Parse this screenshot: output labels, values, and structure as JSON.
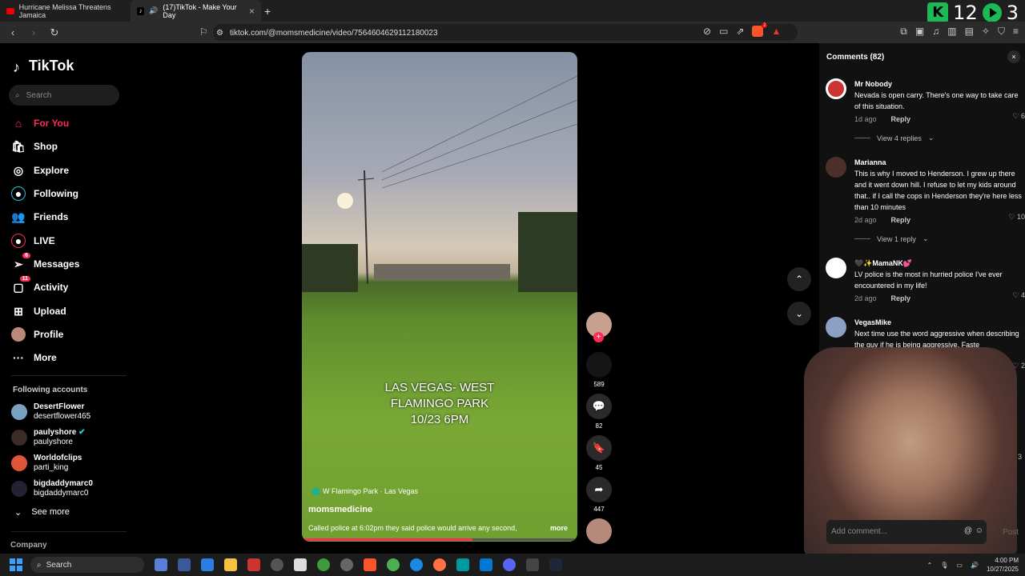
{
  "browser": {
    "tabs": [
      {
        "title": "Hurricane Melissa Threatens Jamaica"
      },
      {
        "title": "(17)TikTok - Make Your Day"
      }
    ],
    "url": "tiktok.com/@momsmedicine/video/7564604629112180023",
    "overlay_score": {
      "left": "12",
      "right": "3"
    },
    "brave_badge": "2"
  },
  "sidebar": {
    "logo": "TikTok",
    "search_placeholder": "Search",
    "nav": [
      {
        "label": "For You",
        "icon": "home-icon"
      },
      {
        "label": "Shop",
        "icon": "shop-icon"
      },
      {
        "label": "Explore",
        "icon": "compass-icon"
      },
      {
        "label": "Following",
        "icon": "following-icon"
      },
      {
        "label": "Friends",
        "icon": "friends-icon"
      },
      {
        "label": "LIVE",
        "icon": "live-icon"
      },
      {
        "label": "Messages",
        "icon": "messages-icon",
        "badge": "6"
      },
      {
        "label": "Activity",
        "icon": "activity-icon",
        "badge": "11"
      },
      {
        "label": "Upload",
        "icon": "upload-icon"
      },
      {
        "label": "Profile",
        "icon": "profile-icon"
      },
      {
        "label": "More",
        "icon": "more-icon"
      }
    ],
    "following_title": "Following accounts",
    "following": [
      {
        "name": "DesertFlower",
        "handle": "desertflower465"
      },
      {
        "name": "paulyshore",
        "handle": "paulyshore"
      },
      {
        "name": "Worldofclips",
        "handle": "parti_king"
      },
      {
        "name": "bigdaddymarc0",
        "handle": "bigdaddymarc0"
      }
    ],
    "see_more": "See more",
    "company": "Company"
  },
  "video": {
    "overlay_text": "LAS VEGAS- WEST\nFLAMINGO PARK\n10/23 6PM",
    "location": "W Flamingo Park · Las Vegas",
    "author": "momsmedicine",
    "caption": "Called police at 6:02pm they said police would arrive any second,",
    "more": "more",
    "progress": 0.62
  },
  "actions": {
    "likes": "589",
    "comments": "82",
    "saves": "45",
    "shares": "447"
  },
  "comments_panel": {
    "title": "Comments (82)",
    "items": [
      {
        "user": "Mr Nobody",
        "text": "Nevada is open carry. There's one way to take care of this situation.",
        "time": "1d ago",
        "reply": "Reply",
        "likes": "6",
        "view_replies": "View 4 replies"
      },
      {
        "user": "Marianna",
        "text": "This is why I moved to Henderson. I grew up there and it went down hill. I refuse to let my kids around that.. if I call the cops in Henderson they're here less than 10 minutes",
        "time": "2d ago",
        "reply": "Reply",
        "likes": "10",
        "view_replies": "View 1 reply"
      },
      {
        "user": "🖤✨MamaNK💕",
        "text": "LV police is the most in hurried police I've ever encountered in my life!",
        "time": "2d ago",
        "reply": "Reply",
        "likes": "4"
      },
      {
        "user": "VegasMike",
        "text": "Next time use the word aggressive when describing the guy if he is being aggressive. Faste",
        "time": "",
        "reply": "",
        "likes": "2"
      }
    ],
    "extra_likes": "3",
    "add_placeholder": "Add comment...",
    "post": "Post"
  },
  "taskbar": {
    "search": "Search",
    "time": "4:00 PM",
    "date": "10/27/2025"
  },
  "colors": {
    "accent": "#fe2c55",
    "bg": "#000000",
    "panel": "#111111"
  }
}
